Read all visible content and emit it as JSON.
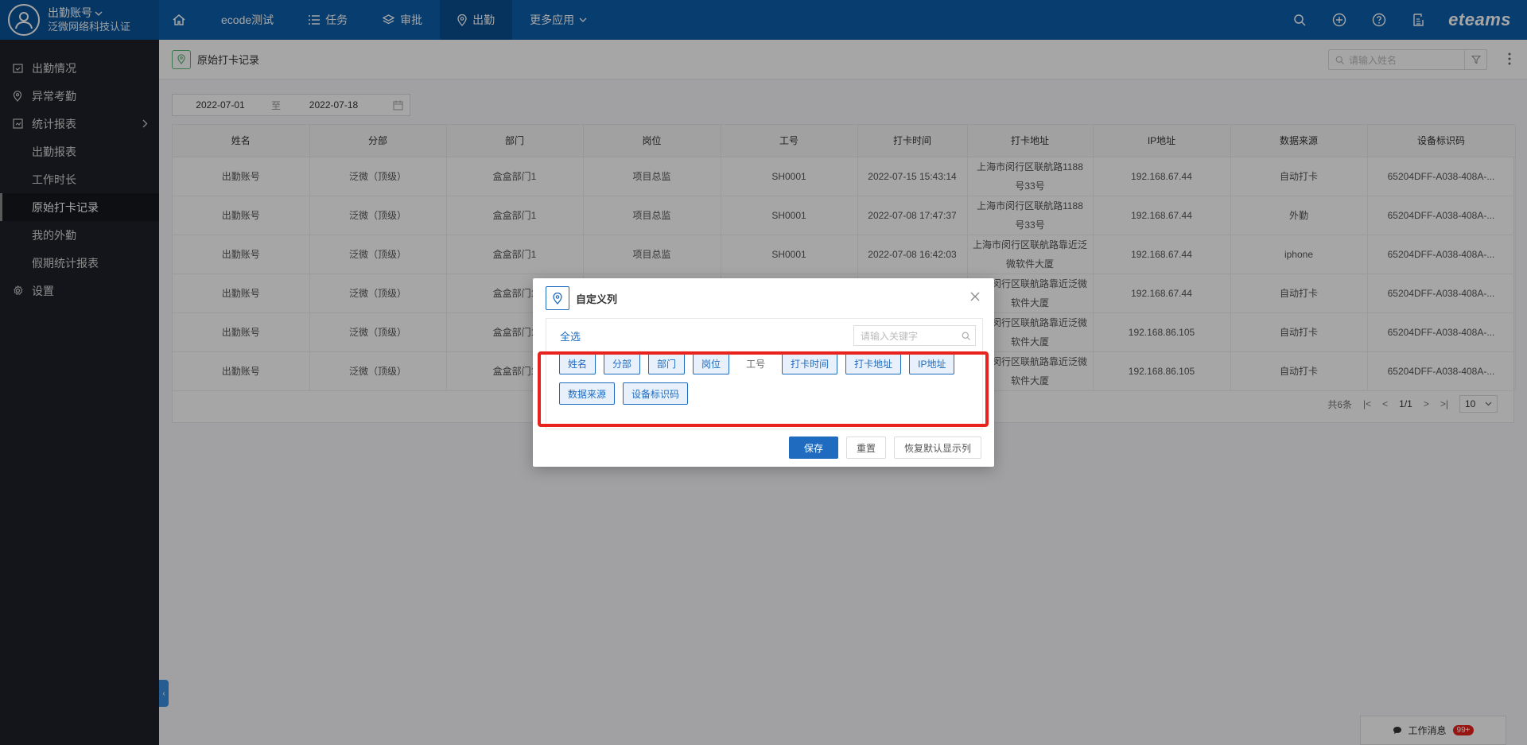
{
  "account": {
    "name": "出勤账号",
    "org": "泛微网络科技认证"
  },
  "nav": {
    "items": [
      {
        "label": "ecode测试"
      },
      {
        "label": "任务"
      },
      {
        "label": "审批"
      },
      {
        "label": "出勤"
      },
      {
        "label": "更多应用"
      }
    ],
    "brand": "eteams"
  },
  "sidebar": {
    "items": [
      {
        "label": "出勤情况"
      },
      {
        "label": "异常考勤"
      },
      {
        "label": "统计报表"
      },
      {
        "label": "出勤报表"
      },
      {
        "label": "工作时长"
      },
      {
        "label": "原始打卡记录"
      },
      {
        "label": "我的外勤"
      },
      {
        "label": "假期统计报表"
      },
      {
        "label": "设置"
      }
    ]
  },
  "page": {
    "title": "原始打卡记录",
    "name_search_placeholder": "请输入姓名",
    "date_start": "2022-07-01",
    "date_sep": "至",
    "date_end": "2022-07-18"
  },
  "table": {
    "headers": [
      "姓名",
      "分部",
      "部门",
      "岗位",
      "工号",
      "打卡时间",
      "打卡地址",
      "IP地址",
      "数据来源",
      "设备标识码"
    ],
    "rows": [
      [
        "出勤账号",
        "泛微（顶级）",
        "盒盒部门1",
        "项目总监",
        "SH0001",
        "2022-07-15 15:43:14",
        "上海市闵行区联航路1188号33号",
        "192.168.67.44",
        "自动打卡",
        "65204DFF-A038-408A-..."
      ],
      [
        "出勤账号",
        "泛微（顶级）",
        "盒盒部门1",
        "项目总监",
        "SH0001",
        "2022-07-08 17:47:37",
        "上海市闵行区联航路1188号33号",
        "192.168.67.44",
        "外勤",
        "65204DFF-A038-408A-..."
      ],
      [
        "出勤账号",
        "泛微（顶级）",
        "盒盒部门1",
        "项目总监",
        "SH0001",
        "2022-07-08 16:42:03",
        "上海市闵行区联航路靠近泛微软件大厦",
        "192.168.67.44",
        "iphone",
        "65204DFF-A038-408A-..."
      ],
      [
        "出勤账号",
        "泛微（顶级）",
        "盒盒部门1",
        "",
        "",
        "",
        "海市闵行区联航路靠近泛微软件大厦",
        "192.168.67.44",
        "自动打卡",
        "65204DFF-A038-408A-..."
      ],
      [
        "出勤账号",
        "泛微（顶级）",
        "盒盒部门1",
        "",
        "",
        "",
        "海市闵行区联航路靠近泛微软件大厦",
        "192.168.86.105",
        "自动打卡",
        "65204DFF-A038-408A-..."
      ],
      [
        "出勤账号",
        "泛微（顶级）",
        "盒盒部门1",
        "",
        "",
        "",
        "海市闵行区联航路靠近泛微软件大厦",
        "192.168.86.105",
        "自动打卡",
        "65204DFF-A038-408A-..."
      ]
    ]
  },
  "pagination": {
    "total": "共6条",
    "current": "1/1",
    "page_size": "10"
  },
  "modal": {
    "title": "自定义列",
    "select_all": "全选",
    "search_placeholder": "请输入关键字",
    "tags": [
      {
        "label": "姓名",
        "selected": true
      },
      {
        "label": "分部",
        "selected": true
      },
      {
        "label": "部门",
        "selected": true
      },
      {
        "label": "岗位",
        "selected": true
      },
      {
        "label": "工号",
        "selected": false
      },
      {
        "label": "打卡时间",
        "selected": true
      },
      {
        "label": "打卡地址",
        "selected": true
      },
      {
        "label": "IP地址",
        "selected": true
      },
      {
        "label": "数据来源",
        "selected": true
      },
      {
        "label": "设备标识码",
        "selected": true
      }
    ],
    "save": "保存",
    "reset": "重置",
    "restore": "恢复默认显示列"
  },
  "message": {
    "label": "工作消息",
    "badge": "99+"
  },
  "colors": {
    "primary": "#1e6bc0",
    "topbar": "#0b5eab",
    "sidebar": "#1f2129",
    "highlight": "#e8221d"
  }
}
